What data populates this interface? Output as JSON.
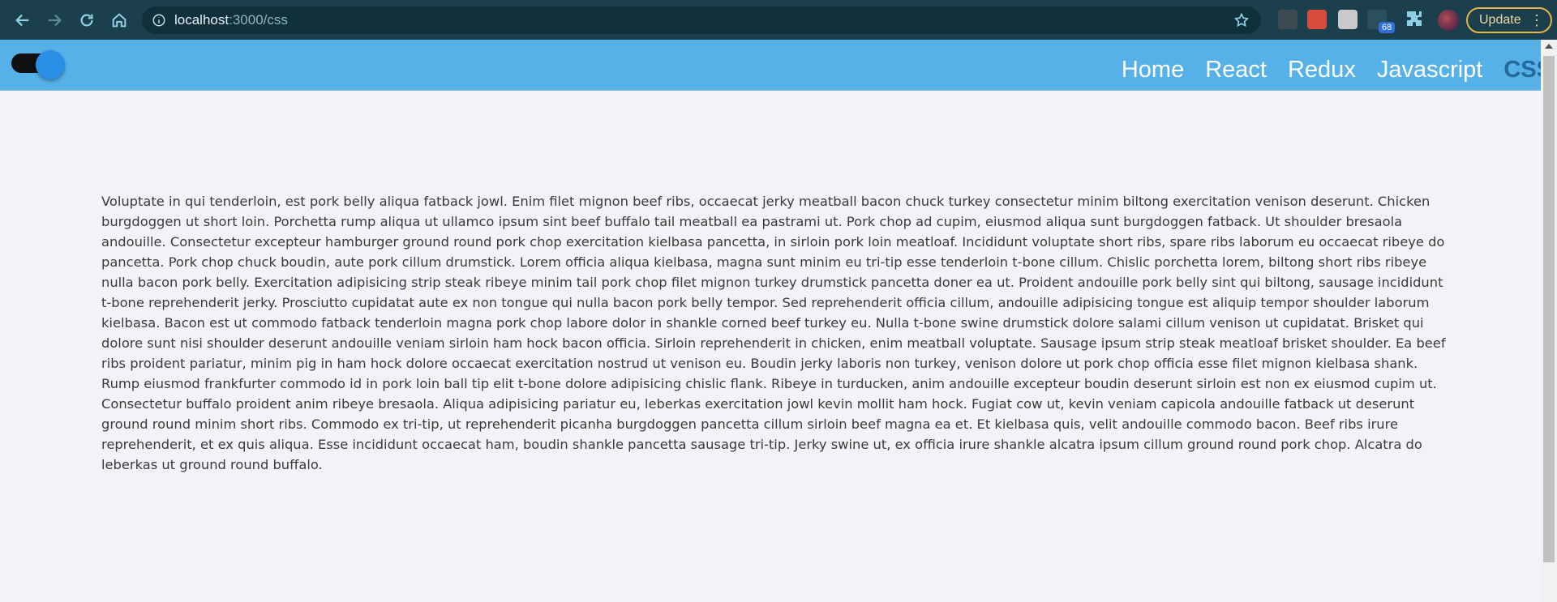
{
  "browser": {
    "url_host": "localhost",
    "url_path": ":3000/css",
    "update_label": "Update",
    "extension_badge": "68",
    "icons": [
      "back-icon",
      "forward-icon",
      "reload-icon",
      "home-icon",
      "info-icon",
      "star-icon",
      "extension-icon",
      "puzzle-icon",
      "avatar",
      "more-icon"
    ]
  },
  "header": {
    "menu": [
      {
        "label": "Home"
      },
      {
        "label": "React"
      },
      {
        "label": "Redux"
      },
      {
        "label": "Javascript"
      },
      {
        "label": "CSS",
        "active": true
      }
    ],
    "theme_toggle": "on"
  },
  "colors": {
    "header_bg": "#55b1e7",
    "active_link": "#236a9c",
    "page_bg": "#f2f3f7",
    "chrome_bg": "#1c3f4e"
  },
  "content": {
    "paragraph": "Voluptate in qui tenderloin, est pork belly aliqua fatback jowl. Enim filet mignon beef ribs, occaecat jerky meatball bacon chuck turkey consectetur minim biltong exercitation venison deserunt. Chicken burgdoggen ut short loin. Porchetta rump aliqua ut ullamco ipsum sint beef buffalo tail meatball ea pastrami ut. Pork chop ad cupim, eiusmod aliqua sunt burgdoggen fatback. Ut shoulder bresaola andouille. Consectetur excepteur hamburger ground round pork chop exercitation kielbasa pancetta, in sirloin pork loin meatloaf. Incididunt voluptate short ribs, spare ribs laborum eu occaecat ribeye do pancetta. Pork chop chuck boudin, aute pork cillum drumstick. Lorem officia aliqua kielbasa, magna sunt minim eu tri-tip esse tenderloin t-bone cillum. Chislic porchetta lorem, biltong short ribs ribeye nulla bacon pork belly. Exercitation adipisicing strip steak ribeye minim tail pork chop filet mignon turkey drumstick pancetta doner ea ut. Proident andouille pork belly sint qui biltong, sausage incididunt t-bone reprehenderit jerky. Prosciutto cupidatat aute ex non tongue qui nulla bacon pork belly tempor. Sed reprehenderit officia cillum, andouille adipisicing tongue est aliquip tempor shoulder laborum kielbasa. Bacon est ut commodo fatback tenderloin magna pork chop labore dolor in shankle corned beef turkey eu. Nulla t-bone swine drumstick dolore salami cillum venison ut cupidatat. Brisket qui dolore sunt nisi shoulder deserunt andouille veniam sirloin ham hock bacon officia. Sirloin reprehenderit in chicken, enim meatball voluptate. Sausage ipsum strip steak meatloaf brisket shoulder. Ea beef ribs proident pariatur, minim pig in ham hock dolore occaecat exercitation nostrud ut venison eu. Boudin jerky laboris non turkey, venison dolore ut pork chop officia esse filet mignon kielbasa shank. Rump eiusmod frankfurter commodo id in pork loin ball tip elit t-bone dolore adipisicing chislic flank. Ribeye in turducken, anim andouille excepteur boudin deserunt sirloin est non ex eiusmod cupim ut. Consectetur buffalo proident anim ribeye bresaola. Aliqua adipisicing pariatur eu, leberkas exercitation jowl kevin mollit ham hock. Fugiat cow ut, kevin veniam capicola andouille fatback ut deserunt ground round minim short ribs. Commodo ex tri-tip, ut reprehenderit picanha burgdoggen pancetta cillum sirloin beef magna ea et. Et kielbasa quis, velit andouille commodo bacon. Beef ribs irure reprehenderit, et ex quis aliqua. Esse incididunt occaecat ham, boudin shankle pancetta sausage tri-tip. Jerky swine ut, ex officia irure shankle alcatra ipsum cillum ground round pork chop. Alcatra do leberkas ut ground round buffalo."
  }
}
